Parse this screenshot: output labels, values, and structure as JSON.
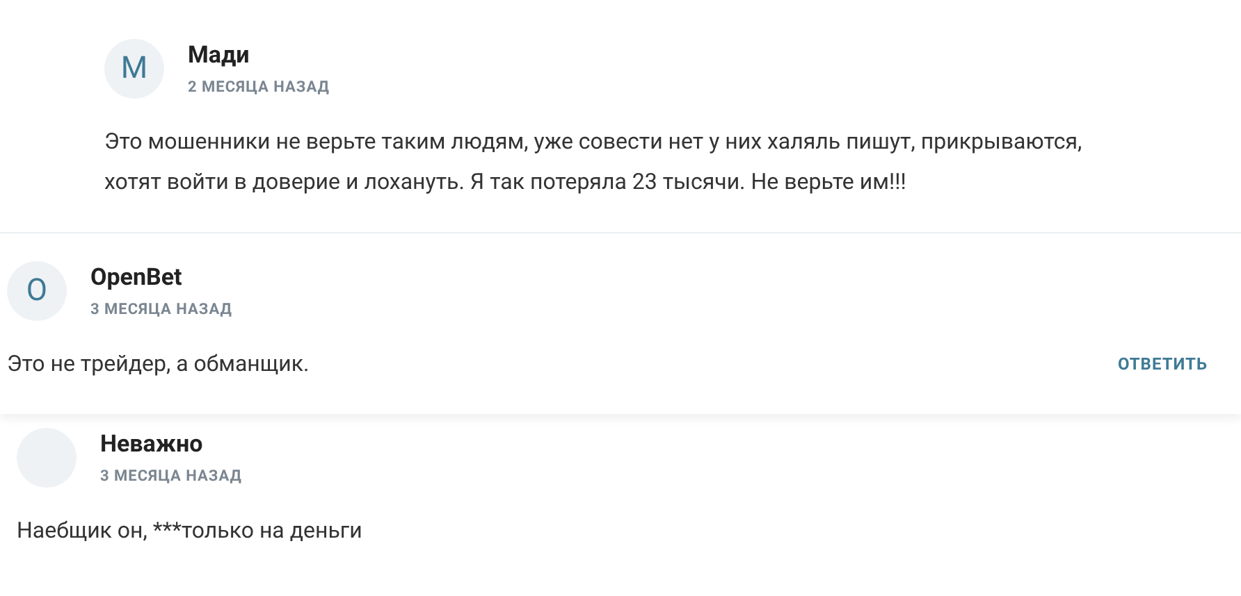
{
  "comments": [
    {
      "kind": "nested",
      "avatar": "М",
      "author": "Мади",
      "date": "2 МЕСЯЦА НАЗАД",
      "text": "Это мошенники не верьте таким людям, уже совести нет у них халяль пишут, прикрываются, хотят войти в доверие и лохануть. Я так потеряла 23 тысячи. Не верьте им!!!"
    },
    {
      "kind": "card",
      "avatar": "О",
      "author": "OpenBet",
      "date": "3 МЕСЯЦА НАЗАД",
      "text": "Это не трейдер, а обманщик.",
      "reply": "ОТВЕТИТЬ"
    },
    {
      "kind": "plain",
      "author": "Неважно",
      "date": "3 МЕСЯЦА НАЗАД",
      "text": "Наебщик он, ***только на деньги"
    }
  ]
}
